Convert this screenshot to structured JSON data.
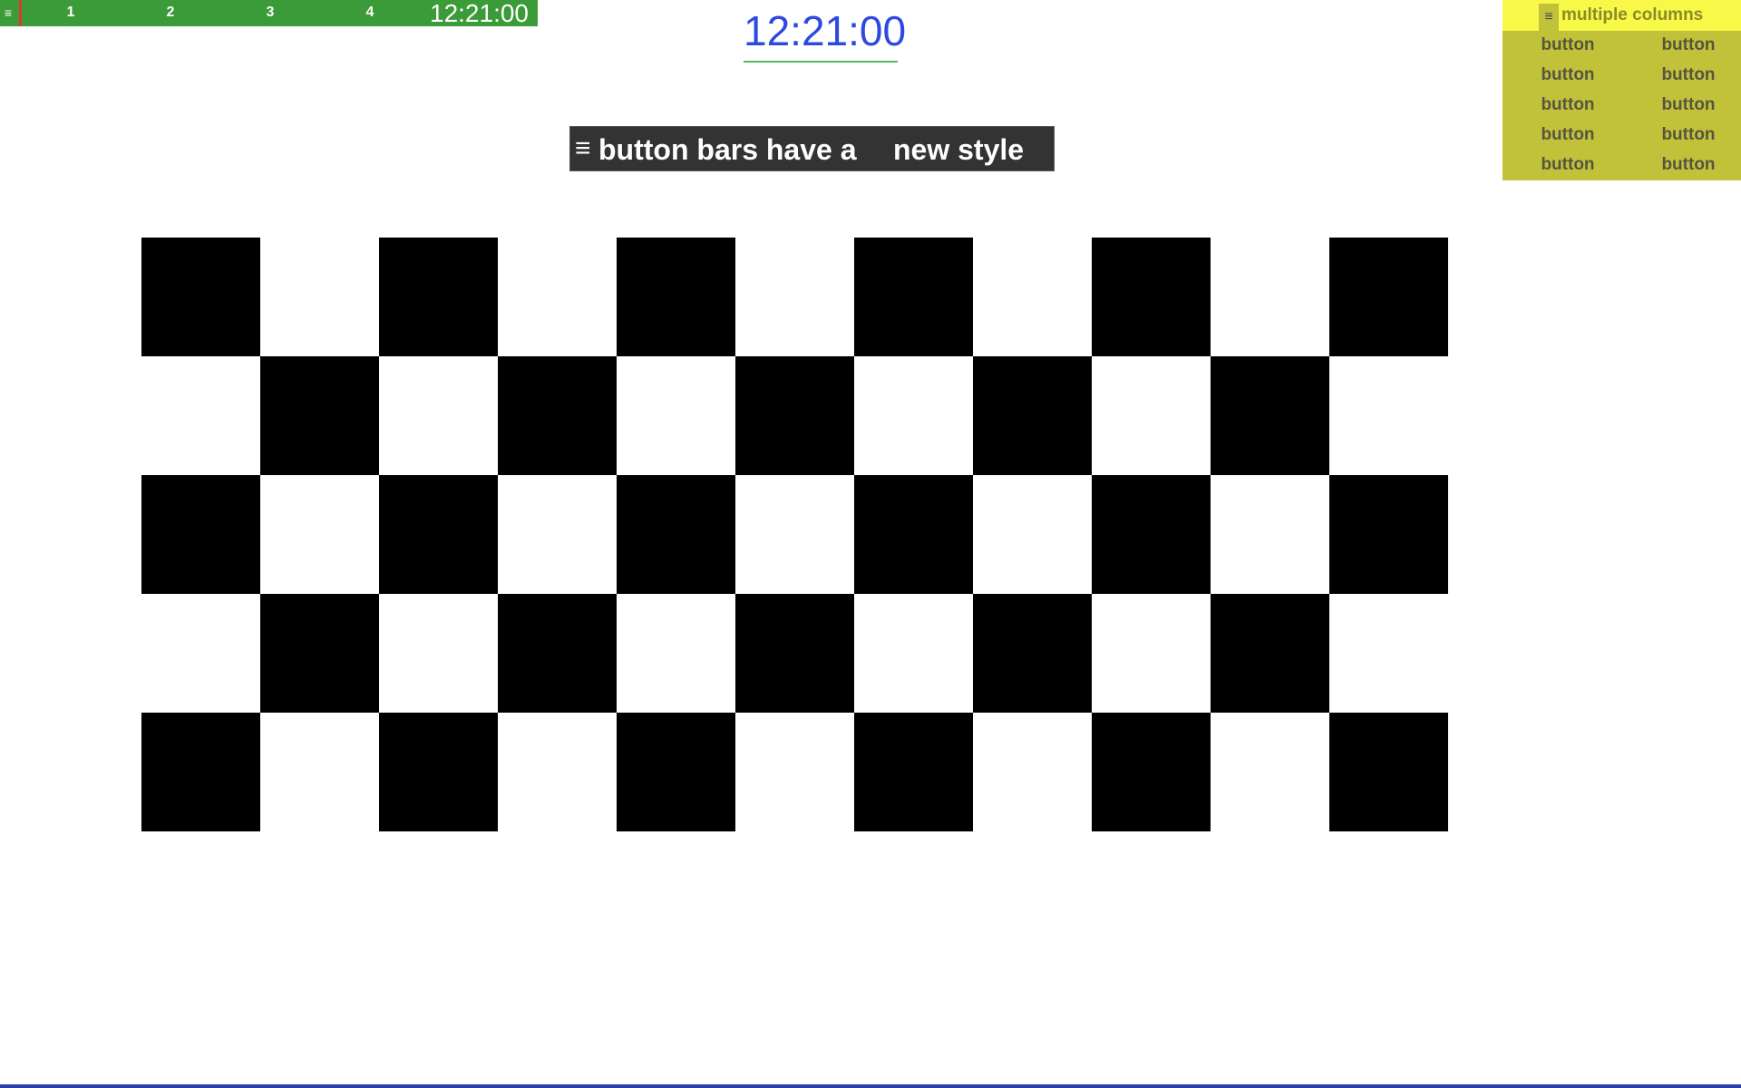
{
  "top_bar": {
    "menu_glyph": "≡",
    "workspaces": [
      "1",
      "2",
      "3",
      "4"
    ],
    "clock": "12:21:00"
  },
  "center_clock": {
    "time": "12:21:00"
  },
  "dark_bar": {
    "menu_glyph": "≡",
    "text_part1": "button bars have a",
    "text_part2": "new style"
  },
  "yellow_panel": {
    "menu_glyph": "≡",
    "title": "multiple columns",
    "buttons": [
      [
        "button",
        "button"
      ],
      [
        "button",
        "button"
      ],
      [
        "button",
        "button"
      ],
      [
        "button",
        "button"
      ],
      [
        "button",
        "button"
      ]
    ]
  },
  "colors": {
    "top_bar_bg": "#3a9b38",
    "cursor": "#d93a2b",
    "clock_text": "#2e49e0",
    "clock_underline": "#52b85a",
    "dark_bar_bg": "#333333",
    "yellow_header_bg": "#f8f848",
    "yellow_body_bg": "#c2c23a",
    "bottom_line": "#2b3fa8"
  },
  "checkerboard": {
    "rows": 5,
    "cols": 11,
    "first_square_black": true
  }
}
